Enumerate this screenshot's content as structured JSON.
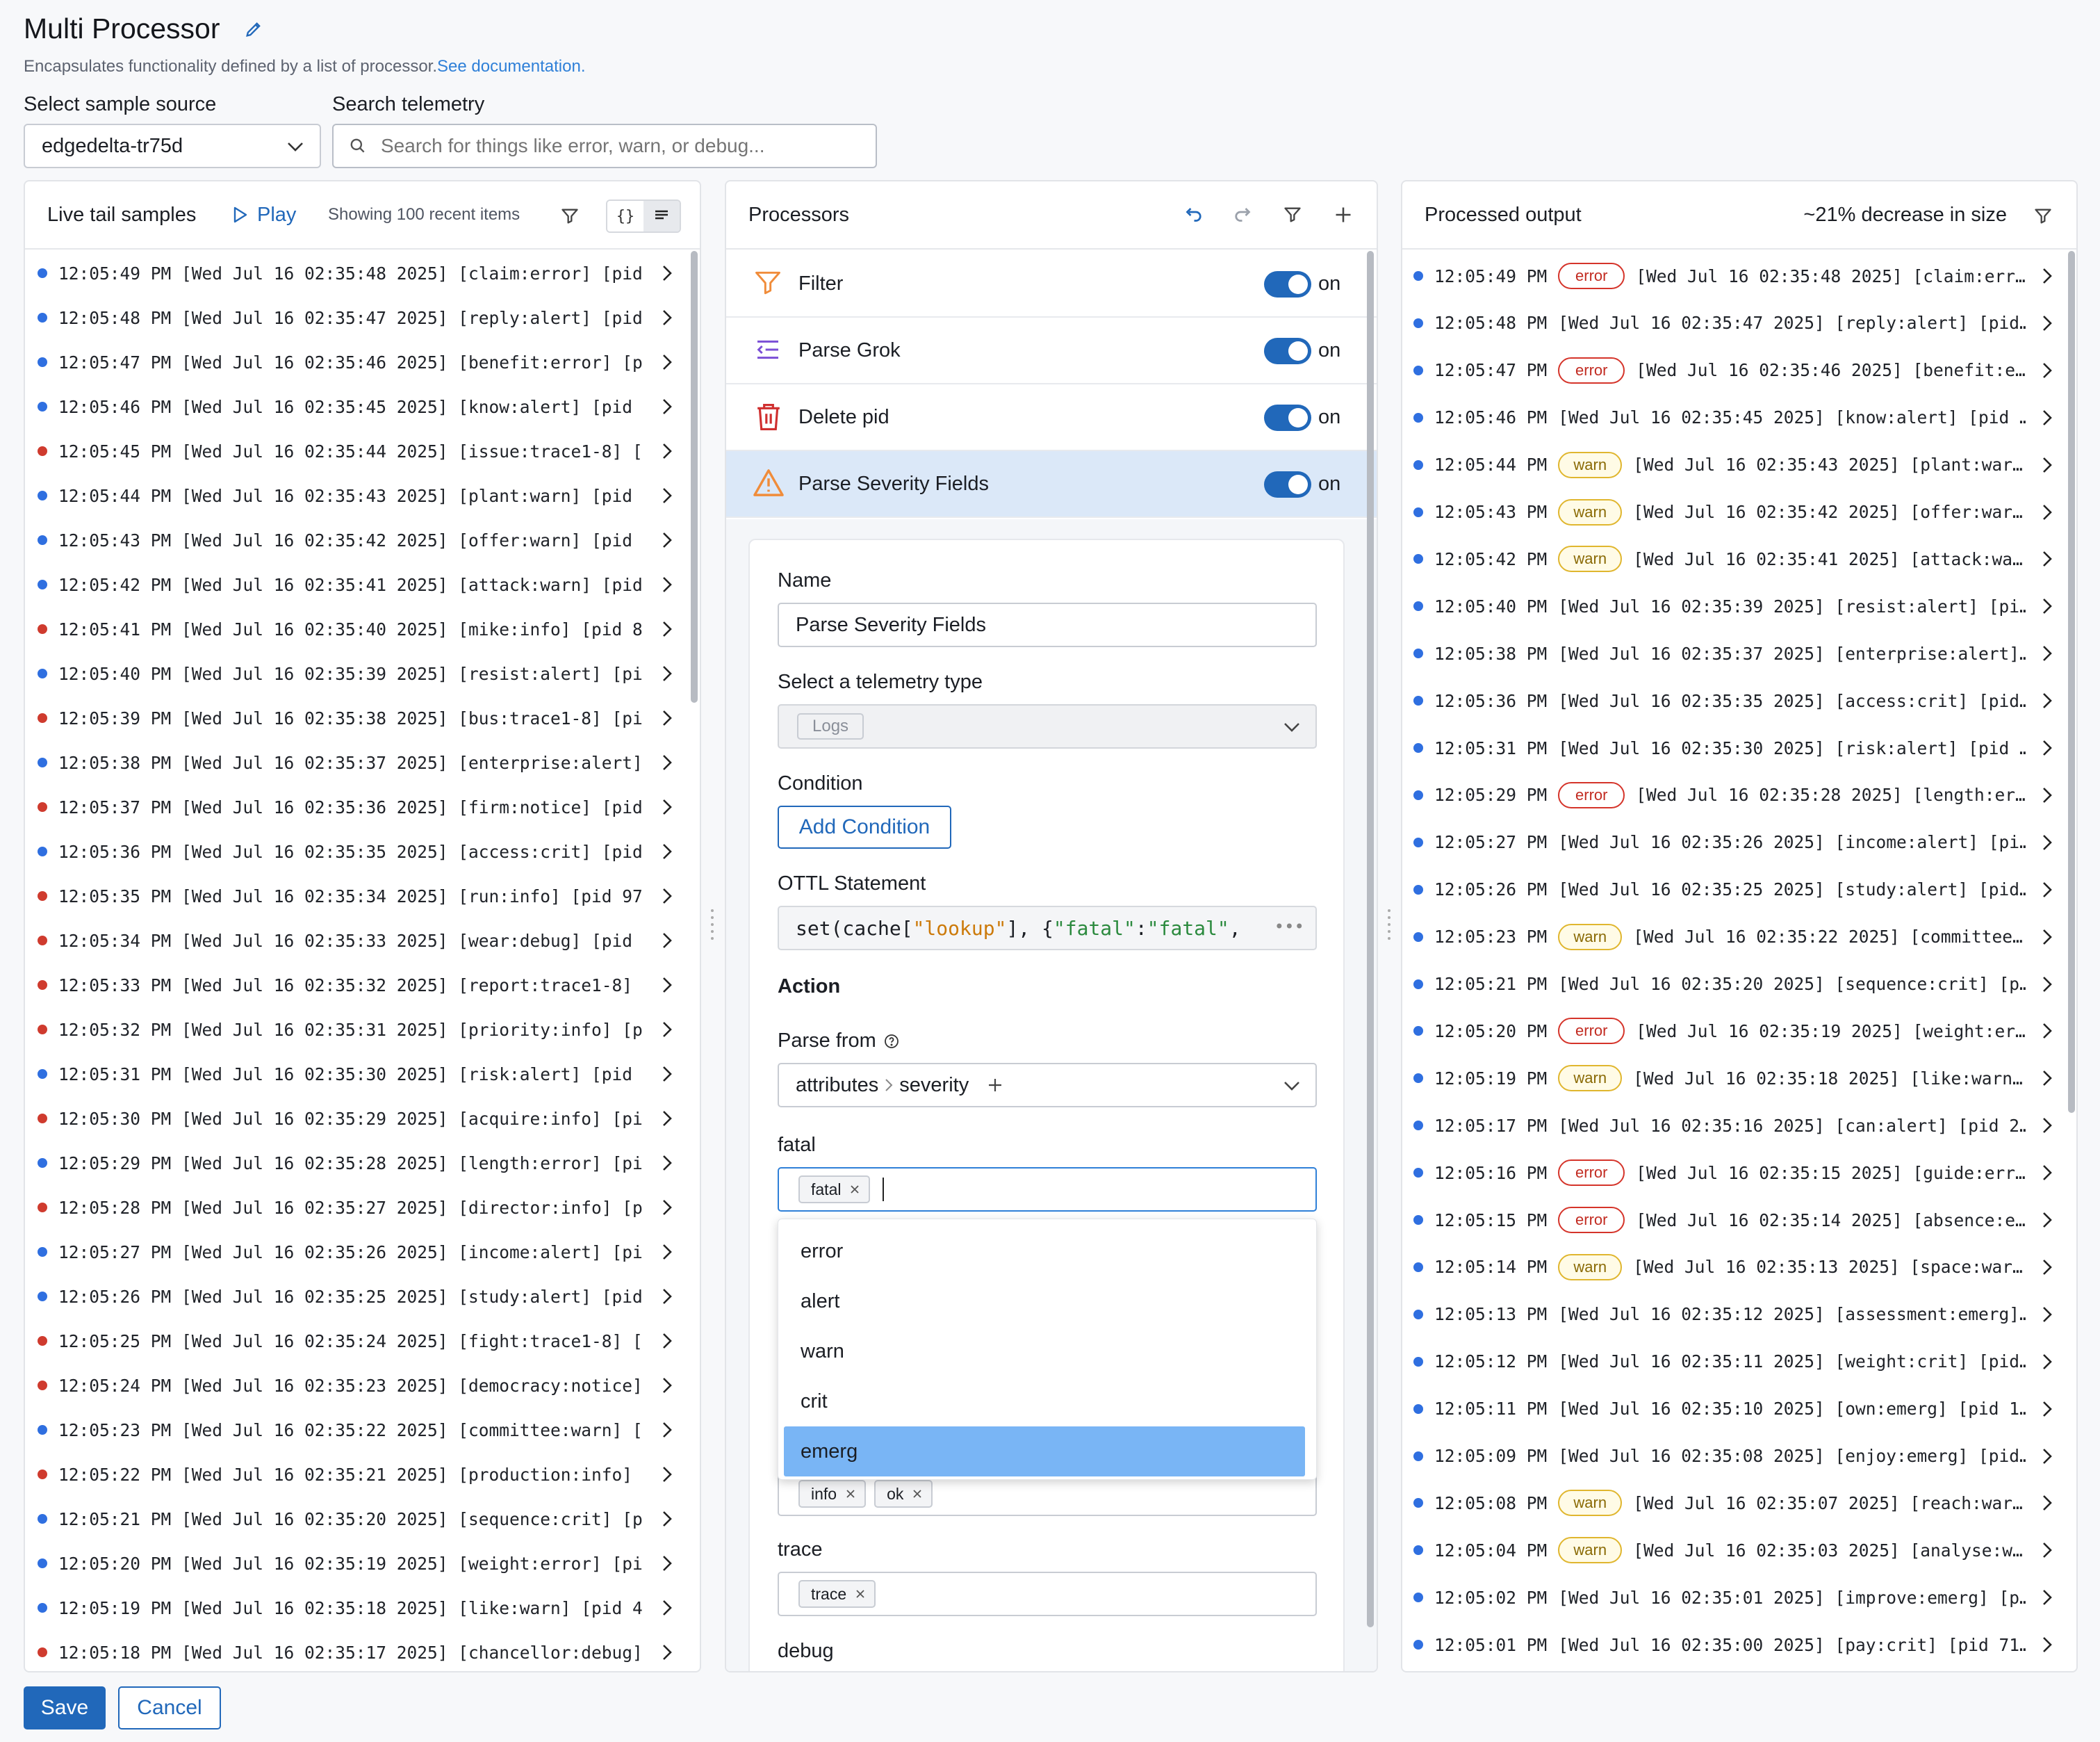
{
  "header": {
    "title": "Multi Processor",
    "description": "Encapsulates functionality defined by a list of processor.",
    "doc_link": "See documentation."
  },
  "sample_source": {
    "label": "Select sample source",
    "value": "edgedelta-tr75d"
  },
  "search": {
    "label": "Search telemetry",
    "placeholder": "Search for things like error, warn, or debug..."
  },
  "live_tail": {
    "title": "Live tail samples",
    "play_label": "Play",
    "showing": "Showing 100 recent items",
    "rows": [
      {
        "c": "blue",
        "t": "12:05:49 PM [Wed Jul 16 02:35:48 2025] [claim:error] [pid…"
      },
      {
        "c": "blue",
        "t": "12:05:48 PM [Wed Jul 16 02:35:47 2025] [reply:alert] [pid…"
      },
      {
        "c": "blue",
        "t": "12:05:47 PM [Wed Jul 16 02:35:46 2025] [benefit:error] [p…"
      },
      {
        "c": "blue",
        "t": "12:05:46 PM [Wed Jul 16 02:35:45 2025] [know:alert] [pid …"
      },
      {
        "c": "red",
        "t": "12:05:45 PM [Wed Jul 16 02:35:44 2025] [issue:trace1-8] […"
      },
      {
        "c": "blue",
        "t": "12:05:44 PM [Wed Jul 16 02:35:43 2025] [plant:warn] [pid …"
      },
      {
        "c": "blue",
        "t": "12:05:43 PM [Wed Jul 16 02:35:42 2025] [offer:warn] [pid …"
      },
      {
        "c": "blue",
        "t": "12:05:42 PM [Wed Jul 16 02:35:41 2025] [attack:warn] [pid…"
      },
      {
        "c": "red",
        "t": "12:05:41 PM [Wed Jul 16 02:35:40 2025] [mike:info] [pid 8…"
      },
      {
        "c": "blue",
        "t": "12:05:40 PM [Wed Jul 16 02:35:39 2025] [resist:alert] [pi…"
      },
      {
        "c": "red",
        "t": "12:05:39 PM [Wed Jul 16 02:35:38 2025] [bus:trace1-8] [pi…"
      },
      {
        "c": "blue",
        "t": "12:05:38 PM [Wed Jul 16 02:35:37 2025] [enterprise:alert]…"
      },
      {
        "c": "red",
        "t": "12:05:37 PM [Wed Jul 16 02:35:36 2025] [firm:notice] [pid…"
      },
      {
        "c": "blue",
        "t": "12:05:36 PM [Wed Jul 16 02:35:35 2025] [access:crit] [pid…"
      },
      {
        "c": "red",
        "t": "12:05:35 PM [Wed Jul 16 02:35:34 2025] [run:info] [pid 97…"
      },
      {
        "c": "red",
        "t": "12:05:34 PM [Wed Jul 16 02:35:33 2025] [wear:debug] [pid …"
      },
      {
        "c": "red",
        "t": "12:05:33 PM [Wed Jul 16 02:35:32 2025] [report:trace1-8] …"
      },
      {
        "c": "red",
        "t": "12:05:32 PM [Wed Jul 16 02:35:31 2025] [priority:info] [p…"
      },
      {
        "c": "blue",
        "t": "12:05:31 PM [Wed Jul 16 02:35:30 2025] [risk:alert] [pid …"
      },
      {
        "c": "red",
        "t": "12:05:30 PM [Wed Jul 16 02:35:29 2025] [acquire:info] [pi…"
      },
      {
        "c": "blue",
        "t": "12:05:29 PM [Wed Jul 16 02:35:28 2025] [length:error] [pi…"
      },
      {
        "c": "red",
        "t": "12:05:28 PM [Wed Jul 16 02:35:27 2025] [director:info] [p…"
      },
      {
        "c": "blue",
        "t": "12:05:27 PM [Wed Jul 16 02:35:26 2025] [income:alert] [pi…"
      },
      {
        "c": "blue",
        "t": "12:05:26 PM [Wed Jul 16 02:35:25 2025] [study:alert] [pid…"
      },
      {
        "c": "red",
        "t": "12:05:25 PM [Wed Jul 16 02:35:24 2025] [fight:trace1-8] […"
      },
      {
        "c": "red",
        "t": "12:05:24 PM [Wed Jul 16 02:35:23 2025] [democracy:notice]…"
      },
      {
        "c": "blue",
        "t": "12:05:23 PM [Wed Jul 16 02:35:22 2025] [committee:warn] […"
      },
      {
        "c": "red",
        "t": "12:05:22 PM [Wed Jul 16 02:35:21 2025] [production:info] …"
      },
      {
        "c": "blue",
        "t": "12:05:21 PM [Wed Jul 16 02:35:20 2025] [sequence:crit] [p…"
      },
      {
        "c": "blue",
        "t": "12:05:20 PM [Wed Jul 16 02:35:19 2025] [weight:error] [pi…"
      },
      {
        "c": "blue",
        "t": "12:05:19 PM [Wed Jul 16 02:35:18 2025] [like:warn] [pid 4…"
      },
      {
        "c": "red",
        "t": "12:05:18 PM [Wed Jul 16 02:35:17 2025] [chancellor:debug]…"
      }
    ]
  },
  "processors": {
    "title": "Processors",
    "toggle_label": "on",
    "items": [
      {
        "name": "Filter",
        "icon": "filter-icon",
        "color": "#f08c3a"
      },
      {
        "name": "Parse Grok",
        "icon": "parse-grok-icon",
        "color": "#7b4fd6"
      },
      {
        "name": "Delete pid",
        "icon": "trash-icon",
        "color": "#cf2f2f"
      },
      {
        "name": "Parse Severity Fields",
        "icon": "warning-icon",
        "color": "#f08c3a"
      }
    ],
    "form": {
      "name_label": "Name",
      "name_value": "Parse Severity Fields",
      "telemetry_label": "Select a telemetry type",
      "telemetry_value": "Logs",
      "condition_label": "Condition",
      "add_condition": "Add Condition",
      "ottl_label": "OTTL Statement",
      "action_label": "Action",
      "parse_from_label": "Parse from",
      "parse_from_a": "attributes",
      "parse_from_b": "severity",
      "fatal_label": "fatal",
      "fatal_tag": "fatal",
      "hidden_tags": [
        "info",
        "ok"
      ],
      "trace_label": "trace",
      "trace_tag": "trace",
      "debug_label": "debug",
      "options": [
        "error",
        "alert",
        "warn",
        "crit",
        "emerg"
      ],
      "selected_option": "emerg"
    }
  },
  "processed": {
    "title": "Processed output",
    "decrease": "~21% decrease in size",
    "rows": [
      {
        "b": "error",
        "t": "12:05:49 PM",
        "m": "[Wed Jul 16 02:35:48 2025] [claim:err…"
      },
      {
        "b": "",
        "t": "12:05:48 PM",
        "m": "[Wed Jul 16 02:35:47 2025] [reply:alert] [pid…"
      },
      {
        "b": "error",
        "t": "12:05:47 PM",
        "m": "[Wed Jul 16 02:35:46 2025] [benefit:e…"
      },
      {
        "b": "",
        "t": "12:05:46 PM",
        "m": "[Wed Jul 16 02:35:45 2025] [know:alert] [pid …"
      },
      {
        "b": "warn",
        "t": "12:05:44 PM",
        "m": "[Wed Jul 16 02:35:43 2025] [plant:war…"
      },
      {
        "b": "warn",
        "t": "12:05:43 PM",
        "m": "[Wed Jul 16 02:35:42 2025] [offer:war…"
      },
      {
        "b": "warn",
        "t": "12:05:42 PM",
        "m": "[Wed Jul 16 02:35:41 2025] [attack:wa…"
      },
      {
        "b": "",
        "t": "12:05:40 PM",
        "m": "[Wed Jul 16 02:35:39 2025] [resist:alert] [pi…"
      },
      {
        "b": "",
        "t": "12:05:38 PM",
        "m": "[Wed Jul 16 02:35:37 2025] [enterprise:alert]…"
      },
      {
        "b": "",
        "t": "12:05:36 PM",
        "m": "[Wed Jul 16 02:35:35 2025] [access:crit] [pid…"
      },
      {
        "b": "",
        "t": "12:05:31 PM",
        "m": "[Wed Jul 16 02:35:30 2025] [risk:alert] [pid …"
      },
      {
        "b": "error",
        "t": "12:05:29 PM",
        "m": "[Wed Jul 16 02:35:28 2025] [length:er…"
      },
      {
        "b": "",
        "t": "12:05:27 PM",
        "m": "[Wed Jul 16 02:35:26 2025] [income:alert] [pi…"
      },
      {
        "b": "",
        "t": "12:05:26 PM",
        "m": "[Wed Jul 16 02:35:25 2025] [study:alert] [pid…"
      },
      {
        "b": "warn",
        "t": "12:05:23 PM",
        "m": "[Wed Jul 16 02:35:22 2025] [committee…"
      },
      {
        "b": "",
        "t": "12:05:21 PM",
        "m": "[Wed Jul 16 02:35:20 2025] [sequence:crit] [p…"
      },
      {
        "b": "error",
        "t": "12:05:20 PM",
        "m": "[Wed Jul 16 02:35:19 2025] [weight:er…"
      },
      {
        "b": "warn",
        "t": "12:05:19 PM",
        "m": "[Wed Jul 16 02:35:18 2025] [like:warn…"
      },
      {
        "b": "",
        "t": "12:05:17 PM",
        "m": "[Wed Jul 16 02:35:16 2025] [can:alert] [pid 2…"
      },
      {
        "b": "error",
        "t": "12:05:16 PM",
        "m": "[Wed Jul 16 02:35:15 2025] [guide:err…"
      },
      {
        "b": "error",
        "t": "12:05:15 PM",
        "m": "[Wed Jul 16 02:35:14 2025] [absence:e…"
      },
      {
        "b": "warn",
        "t": "12:05:14 PM",
        "m": "[Wed Jul 16 02:35:13 2025] [space:war…"
      },
      {
        "b": "",
        "t": "12:05:13 PM",
        "m": "[Wed Jul 16 02:35:12 2025] [assessment:emerg]…"
      },
      {
        "b": "",
        "t": "12:05:12 PM",
        "m": "[Wed Jul 16 02:35:11 2025] [weight:crit] [pid…"
      },
      {
        "b": "",
        "t": "12:05:11 PM",
        "m": "[Wed Jul 16 02:35:10 2025] [own:emerg] [pid 1…"
      },
      {
        "b": "",
        "t": "12:05:09 PM",
        "m": "[Wed Jul 16 02:35:08 2025] [enjoy:emerg] [pid…"
      },
      {
        "b": "warn",
        "t": "12:05:08 PM",
        "m": "[Wed Jul 16 02:35:07 2025] [reach:war…"
      },
      {
        "b": "warn",
        "t": "12:05:04 PM",
        "m": "[Wed Jul 16 02:35:03 2025] [analyse:w…"
      },
      {
        "b": "",
        "t": "12:05:02 PM",
        "m": "[Wed Jul 16 02:35:01 2025] [improve:emerg] [p…"
      },
      {
        "b": "",
        "t": "12:05:01 PM",
        "m": "[Wed Jul 16 02:35:00 2025] [pay:crit] [pid 71…"
      }
    ]
  },
  "footer": {
    "save": "Save",
    "cancel": "Cancel"
  },
  "colors": {
    "accent": "#2168ba",
    "dot_blue": "#2f6fe0",
    "dot_red": "#cf3b2e",
    "selected_bg": "#79b5f5",
    "selected_row_bg": "#dbe8f8"
  }
}
